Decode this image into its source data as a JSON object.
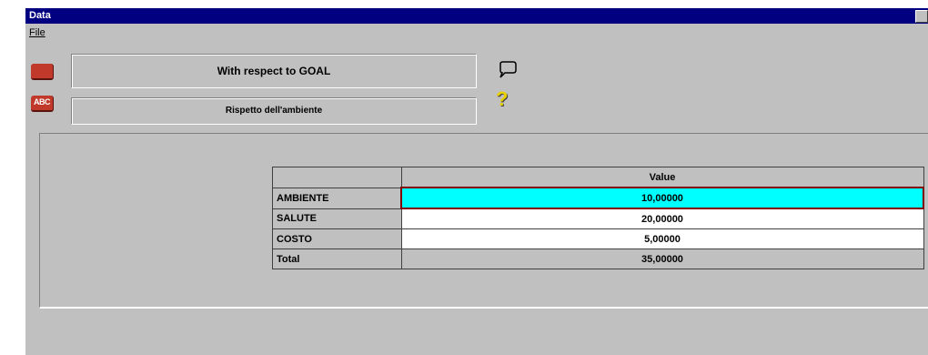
{
  "window": {
    "title": "Data"
  },
  "menu": {
    "file": "File"
  },
  "toolbar": {
    "abc_label": "ABC"
  },
  "fields": {
    "goal": "With respect to GOAL",
    "description": "Rispetto dell'ambiente"
  },
  "table": {
    "header_value": "Value",
    "rows": [
      {
        "label": "AMBIENTE",
        "value": "10,00000"
      },
      {
        "label": "SALUTE",
        "value": "20,00000"
      },
      {
        "label": "COSTO",
        "value": "5,00000"
      },
      {
        "label": "Total",
        "value": "35,00000"
      }
    ]
  },
  "colors": {
    "selected_cell": "#00ffff",
    "titlebar": "#000080"
  },
  "icons": [
    "speech-balloon-icon",
    "help-question-icon",
    "red-button-icon",
    "abc-icon"
  ]
}
